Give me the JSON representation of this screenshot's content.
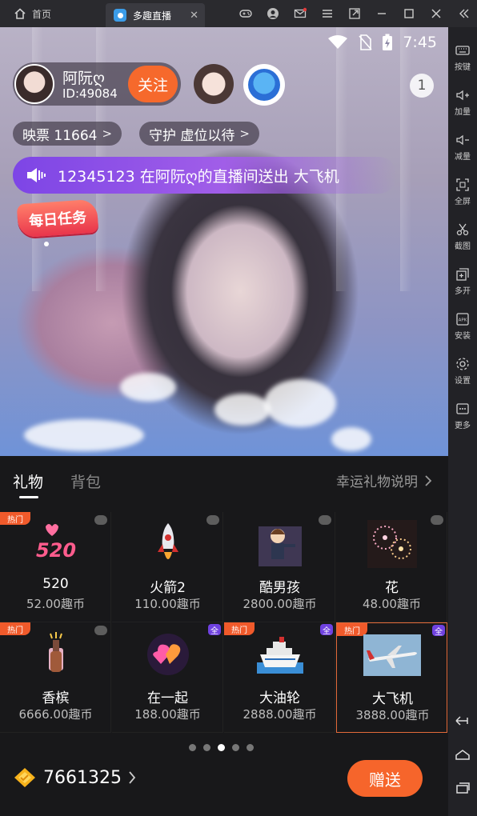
{
  "titlebar": {
    "home_label": "首页",
    "tab_label": "多趣直播",
    "close_symbol": "✕",
    "icons": [
      "gamepad-icon",
      "user-icon",
      "mail-icon",
      "menu-icon",
      "popout-icon",
      "minimize-icon",
      "maximize-icon",
      "close-icon",
      "collapse-icon"
    ]
  },
  "sidebar": {
    "items": [
      {
        "label": "按键",
        "icon": "keyboard-icon"
      },
      {
        "label": "加量",
        "icon": "volume-up-icon"
      },
      {
        "label": "减量",
        "icon": "volume-down-icon"
      },
      {
        "label": "全屏",
        "icon": "fullscreen-icon"
      },
      {
        "label": "截图",
        "icon": "scissors-icon"
      },
      {
        "label": "多开",
        "icon": "multi-open-icon"
      },
      {
        "label": "安装",
        "icon": "apk-icon"
      },
      {
        "label": "设置",
        "icon": "gear-icon"
      },
      {
        "label": "更多",
        "icon": "more-icon"
      }
    ],
    "bottom_icons": [
      "back-icon",
      "home-icon",
      "recents-icon"
    ]
  },
  "status": {
    "time": "7:45"
  },
  "anchor": {
    "name": "阿阮ღ",
    "id": "ID:49084",
    "follow_label": "关注",
    "viewer_count": "1"
  },
  "chips": {
    "tickets": "映票 11664",
    "guard": "守护 虚位以待"
  },
  "banner": {
    "text": "12345123 在阿阮ღ的直播间送出 大飞机"
  },
  "daily_task": "每日任务",
  "panel": {
    "tab_gift": "礼物",
    "tab_bag": "背包",
    "lucky_gift_link": "幸运礼物说明",
    "hot_label": "热门",
    "all_label": "全",
    "gifts": [
      {
        "name": "520",
        "price": "52.00趣币",
        "hot": true,
        "all": false,
        "image": "520-icon"
      },
      {
        "name": "火箭2",
        "price": "110.00趣币",
        "hot": false,
        "all": false,
        "image": "rocket-icon"
      },
      {
        "name": "酷男孩",
        "price": "2800.00趣币",
        "hot": false,
        "all": false,
        "image": "cool-boy-icon"
      },
      {
        "name": "花",
        "price": "48.00趣币",
        "hot": false,
        "all": false,
        "image": "fireworks-icon"
      },
      {
        "name": "香槟",
        "price": "6666.00趣币",
        "hot": true,
        "all": false,
        "image": "champagne-icon"
      },
      {
        "name": "在一起",
        "price": "188.00趣币",
        "hot": false,
        "all": true,
        "image": "hearts-icon"
      },
      {
        "name": "大油轮",
        "price": "2888.00趣币",
        "hot": true,
        "all": true,
        "image": "cruise-ship-icon"
      },
      {
        "name": "大飞机",
        "price": "3888.00趣币",
        "hot": true,
        "all": true,
        "image": "airplane-icon",
        "selected": true
      }
    ],
    "page_count": 5,
    "current_page": 3,
    "balance": "7661325",
    "send_label": "赠送"
  },
  "colors": {
    "accent": "#f6652b",
    "banner": "#8a4fe6",
    "panel_bg": "#18181a",
    "hot_badge": "#f05a2b",
    "all_badge": "#6f41e0"
  }
}
